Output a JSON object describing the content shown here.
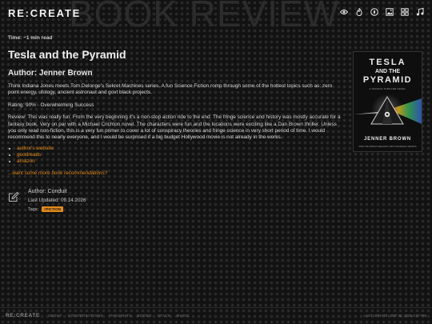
{
  "header": {
    "logo": "RE:CREATE",
    "watermark": "BOOK REVIEW",
    "icons": [
      "eye-icon",
      "flame-icon",
      "compass-icon",
      "image-icon",
      "grid-icon",
      "music-icon"
    ]
  },
  "article": {
    "time": "Time: ~1 min read",
    "title": "Tesla and the Pyramid",
    "author_heading": "Author: Jenner Brown",
    "intro": "Think Indiana Jones meets Tom Delonge's Sekret Machines series. A fun Science Fiction romp through some of the hottest topics such as: zero point energy, ufology, ancient astronaut and govt black projects.",
    "rating": "Rating: 90% - Overwhelming Success",
    "review": "Review: This was really fun. From the very beginning it's a non-stop action ride to the end. The fringe science and history was mostly accurate for a fantasy book. Very on par with a Michael Crichton novel. The characters were fun and the locations were exciting like a Dan Brown thriller. Unless you only read non-fiction, this is a very fun primer to cover a lot of conspiracy theories and fringe science in very short period of time. I would recommend this to nearly everyone, and I would be surprised if a big budget Hollywood movie is not already in the works.",
    "links": [
      "author's website",
      "goodreads",
      "amazon"
    ],
    "more_link": "...want some more book recommendations?"
  },
  "meta": {
    "author": "Author: Conduit",
    "updated": "Last Updated: 09.14.2026",
    "tags_label": "Tags:",
    "tag": "#FICTION"
  },
  "cover": {
    "title_line1": "TESLA",
    "title_line2": "AND THE",
    "title_line3": "PYRAMID",
    "subtitle": "A TECHNO-THRILLER NOVEL",
    "author": "JENNER BROWN",
    "blurb": "WHAT THE WORLD'S RELEVANT UNITE THE REVEAL SECRETS"
  },
  "footer": {
    "logo": "RE:CREATE",
    "version": "2.0",
    "nav": [
      "ABOUT",
      "CONVERSATIONS",
      "THOUGHTS",
      "BOOKS",
      "STACK",
      "MUSIC"
    ],
    "last_update": "LAST UPDATE: SEP 25, 2026 4:57 PM"
  },
  "colors": {
    "accent": "#e38a1b",
    "background": "#121212",
    "text": "#d4d4d4"
  }
}
